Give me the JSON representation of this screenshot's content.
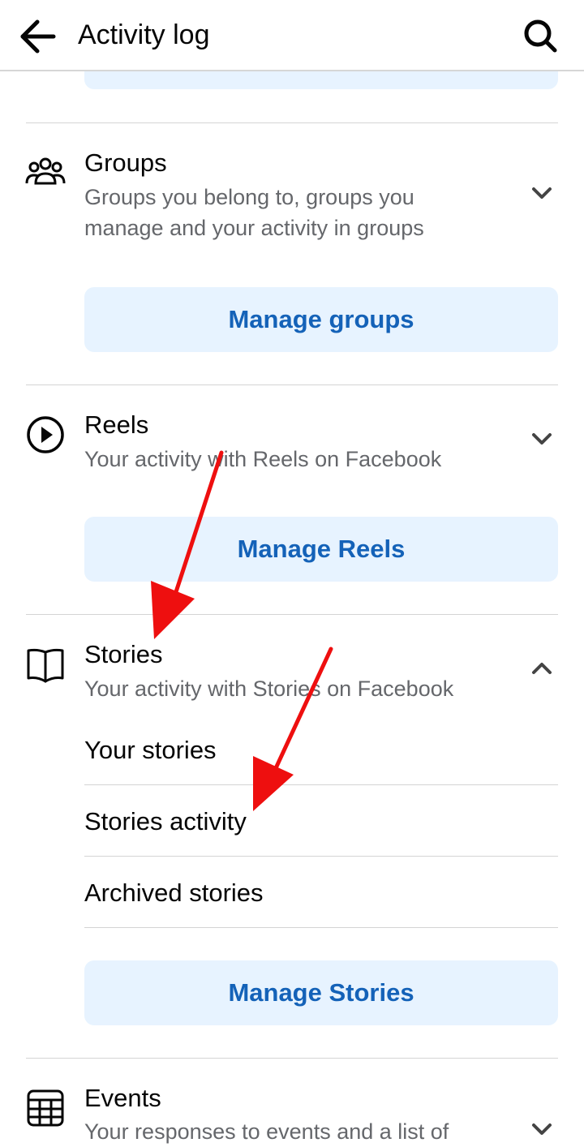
{
  "header": {
    "title": "Activity log"
  },
  "sections": {
    "groups": {
      "title": "Groups",
      "subtitle": "Groups you belong to, groups you manage and your activity in groups",
      "button": "Manage groups"
    },
    "reels": {
      "title": "Reels",
      "subtitle": "Your activity with Reels on Facebook",
      "button": "Manage Reels"
    },
    "stories": {
      "title": "Stories",
      "subtitle": "Your activity with Stories on Facebook",
      "items": [
        "Your stories",
        "Stories activity",
        "Archived stories"
      ],
      "button": "Manage Stories"
    },
    "events": {
      "title": "Events",
      "subtitle": "Your responses to events and a list of"
    }
  },
  "colors": {
    "accent_text": "#1462b8",
    "button_bg": "#e7f3ff",
    "annotation_arrow": "#ee0f0f"
  },
  "icons": {
    "back": "arrow-left-icon",
    "search": "search-icon",
    "groups": "people-group-icon",
    "reels": "play-circle-icon",
    "stories": "open-book-icon",
    "events": "calendar-icon"
  }
}
